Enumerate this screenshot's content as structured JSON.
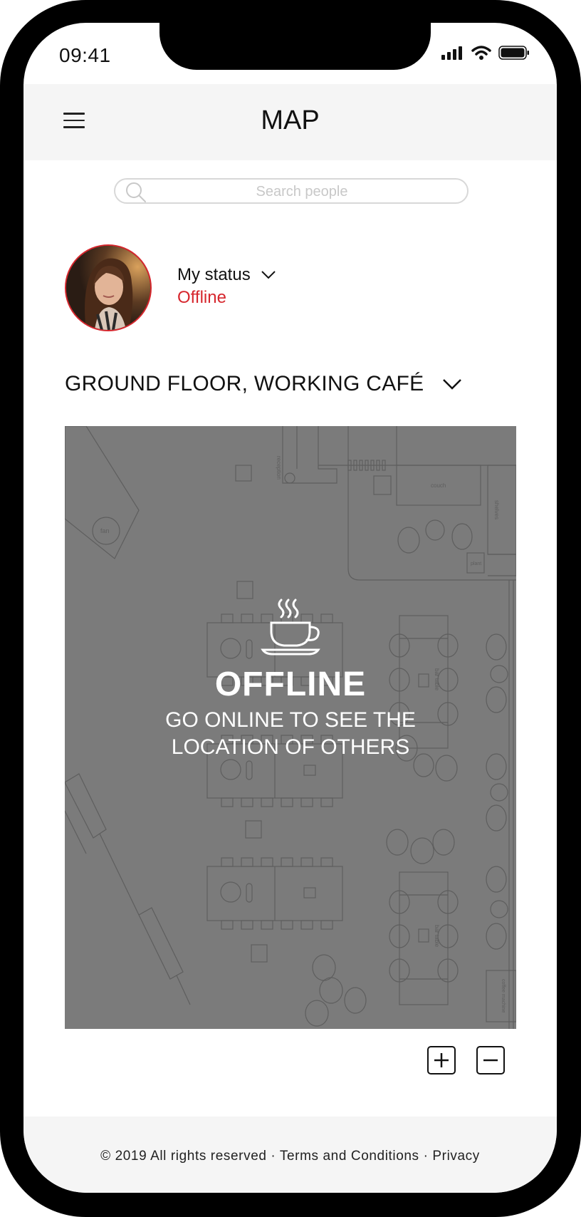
{
  "status_bar": {
    "time": "09:41"
  },
  "app_bar": {
    "title": "MAP"
  },
  "search": {
    "placeholder": "Search people",
    "value": ""
  },
  "user": {
    "status_label": "My status",
    "status_value": "Offline"
  },
  "floor": {
    "selected": "GROUND FLOOR, WORKING CAFÉ"
  },
  "map": {
    "overlay_title": "OFFLINE",
    "overlay_line1": "GO ONLINE TO SEE THE",
    "overlay_line2": "LOCATION OF OTHERS",
    "labels": {
      "reception": "reception",
      "couch": "couch",
      "shelves": "shelves",
      "plant": "plant",
      "lamp": "lamp",
      "bar_table": "bar table",
      "coffee_machine": "coffee machine"
    }
  },
  "zoom": {
    "in_label": "+",
    "out_label": "−"
  },
  "footer": {
    "copyright": "© 2019 All rights reserved",
    "separator": "·",
    "terms": "Terms and Conditions",
    "privacy": "Privacy"
  },
  "colors": {
    "accent": "#d6262d",
    "map_bg": "#7b7b7b",
    "bar_bg": "#f5f5f5"
  },
  "icons": [
    "hamburger-menu-icon",
    "search-icon",
    "chevron-down-icon",
    "coffee-cup-icon",
    "plus-icon",
    "minus-icon",
    "signal-icon",
    "wifi-icon",
    "battery-icon"
  ]
}
